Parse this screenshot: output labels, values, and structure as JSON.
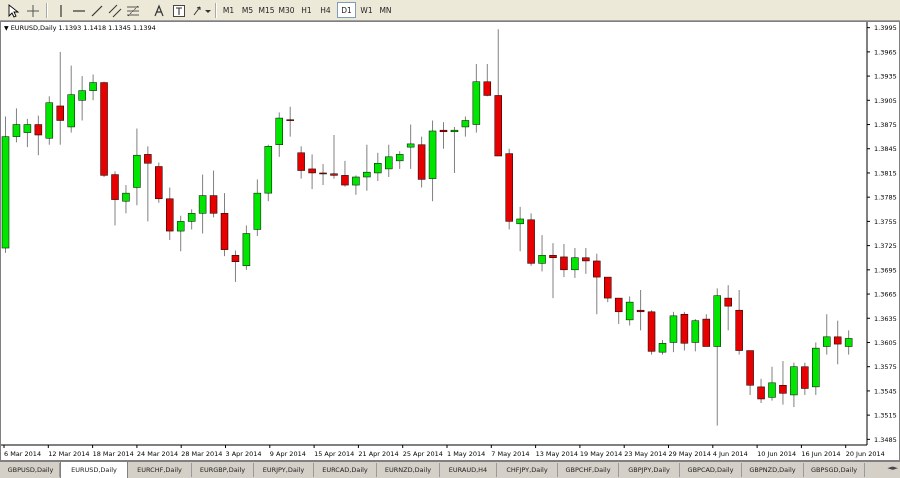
{
  "toolbar": {
    "tools": [
      {
        "name": "cursor-icon"
      },
      {
        "name": "crosshair-icon"
      },
      {
        "name": "vertical-line-icon"
      },
      {
        "name": "horizontal-line-icon"
      },
      {
        "name": "trendline-icon"
      },
      {
        "name": "equidistant-channel-icon"
      },
      {
        "name": "fibonacci-icon"
      },
      {
        "name": "text-icon"
      },
      {
        "name": "text-label-icon"
      },
      {
        "name": "arrows-menu-icon"
      }
    ],
    "timeframes": [
      "M1",
      "M5",
      "M15",
      "M30",
      "H1",
      "H4",
      "D1",
      "W1",
      "MN"
    ],
    "active_timeframe": "D1"
  },
  "chart": {
    "header": "EURUSD,Daily  1.1393 1.1418 1.1345 1.1394",
    "price_labels": [
      "1.3995",
      "1.3965",
      "1.3935",
      "1.3905",
      "1.3875",
      "1.3845",
      "1.3815",
      "1.3785",
      "1.3755",
      "1.3725",
      "1.3695",
      "1.3665",
      "1.3635",
      "1.3605",
      "1.3575",
      "1.3545",
      "1.3515",
      "1.3485"
    ],
    "date_labels": [
      "6 Mar 2014",
      "12 Mar 2014",
      "18 Mar 2014",
      "24 Mar 2014",
      "28 Mar 2014",
      "3 Apr 2014",
      "9 Apr 2014",
      "15 Apr 2014",
      "21 Apr 2014",
      "25 Apr 2014",
      "1 May 2014",
      "7 May 2014",
      "13 May 2014",
      "19 May 2014",
      "23 May 2014",
      "29 May 2014",
      "4 Jun 2014",
      "10 Jun 2014",
      "16 Jun 2014",
      "20 Jun 2014"
    ],
    "colors": {
      "bull": "#00e600",
      "bear": "#e60000",
      "wick": "#808080",
      "outline": "#000000"
    }
  },
  "chart_data": {
    "type": "candlestick",
    "symbol": "EURUSD",
    "timeframe": "Daily",
    "y_range": [
      1.3478,
      1.4002
    ],
    "candles": [
      {
        "o": 1.3722,
        "h": 1.3885,
        "l": 1.3716,
        "c": 1.386
      },
      {
        "o": 1.386,
        "h": 1.3895,
        "l": 1.3853,
        "c": 1.3875
      },
      {
        "o": 1.3865,
        "h": 1.3882,
        "l": 1.3847,
        "c": 1.3875
      },
      {
        "o": 1.3875,
        "h": 1.3886,
        "l": 1.3837,
        "c": 1.3862
      },
      {
        "o": 1.3858,
        "h": 1.391,
        "l": 1.385,
        "c": 1.3902
      },
      {
        "o": 1.3898,
        "h": 1.3965,
        "l": 1.385,
        "c": 1.388
      },
      {
        "o": 1.3872,
        "h": 1.3948,
        "l": 1.3865,
        "c": 1.3912
      },
      {
        "o": 1.3905,
        "h": 1.3935,
        "l": 1.388,
        "c": 1.3917
      },
      {
        "o": 1.3917,
        "h": 1.3937,
        "l": 1.3905,
        "c": 1.3927
      },
      {
        "o": 1.3927,
        "h": 1.3928,
        "l": 1.381,
        "c": 1.3812
      },
      {
        "o": 1.3813,
        "h": 1.3817,
        "l": 1.375,
        "c": 1.3782
      },
      {
        "o": 1.378,
        "h": 1.38,
        "l": 1.3765,
        "c": 1.379
      },
      {
        "o": 1.3797,
        "h": 1.387,
        "l": 1.3775,
        "c": 1.3837
      },
      {
        "o": 1.3838,
        "h": 1.3848,
        "l": 1.3755,
        "c": 1.3827
      },
      {
        "o": 1.3823,
        "h": 1.3828,
        "l": 1.3778,
        "c": 1.3783
      },
      {
        "o": 1.3783,
        "h": 1.3797,
        "l": 1.3732,
        "c": 1.3743
      },
      {
        "o": 1.3743,
        "h": 1.3762,
        "l": 1.3718,
        "c": 1.3755
      },
      {
        "o": 1.3755,
        "h": 1.377,
        "l": 1.3745,
        "c": 1.3765
      },
      {
        "o": 1.3765,
        "h": 1.3813,
        "l": 1.374,
        "c": 1.3787
      },
      {
        "o": 1.3787,
        "h": 1.3818,
        "l": 1.376,
        "c": 1.3765
      },
      {
        "o": 1.3765,
        "h": 1.379,
        "l": 1.3712,
        "c": 1.372
      },
      {
        "o": 1.3713,
        "h": 1.3719,
        "l": 1.368,
        "c": 1.3705
      },
      {
        "o": 1.37,
        "h": 1.375,
        "l": 1.3695,
        "c": 1.374
      },
      {
        "o": 1.3745,
        "h": 1.3807,
        "l": 1.3737,
        "c": 1.379
      },
      {
        "o": 1.379,
        "h": 1.385,
        "l": 1.378,
        "c": 1.3848
      },
      {
        "o": 1.385,
        "h": 1.389,
        "l": 1.3835,
        "c": 1.3883
      },
      {
        "o": 1.3881,
        "h": 1.3897,
        "l": 1.386,
        "c": 1.388
      },
      {
        "o": 1.384,
        "h": 1.3848,
        "l": 1.3808,
        "c": 1.3818
      },
      {
        "o": 1.382,
        "h": 1.3838,
        "l": 1.3795,
        "c": 1.3815
      },
      {
        "o": 1.3815,
        "h": 1.3826,
        "l": 1.38,
        "c": 1.3814
      },
      {
        "o": 1.3814,
        "h": 1.3862,
        "l": 1.3808,
        "c": 1.3812
      },
      {
        "o": 1.3812,
        "h": 1.383,
        "l": 1.3798,
        "c": 1.38
      },
      {
        "o": 1.38,
        "h": 1.3812,
        "l": 1.3788,
        "c": 1.381
      },
      {
        "o": 1.381,
        "h": 1.385,
        "l": 1.3793,
        "c": 1.3816
      },
      {
        "o": 1.3815,
        "h": 1.384,
        "l": 1.3805,
        "c": 1.3827
      },
      {
        "o": 1.382,
        "h": 1.385,
        "l": 1.381,
        "c": 1.3835
      },
      {
        "o": 1.383,
        "h": 1.3842,
        "l": 1.382,
        "c": 1.3838
      },
      {
        "o": 1.3847,
        "h": 1.3875,
        "l": 1.382,
        "c": 1.3851
      },
      {
        "o": 1.385,
        "h": 1.386,
        "l": 1.3797,
        "c": 1.3807
      },
      {
        "o": 1.3808,
        "h": 1.388,
        "l": 1.378,
        "c": 1.3867
      },
      {
        "o": 1.3868,
        "h": 1.3878,
        "l": 1.3845,
        "c": 1.3866
      },
      {
        "o": 1.3866,
        "h": 1.3872,
        "l": 1.3815,
        "c": 1.3868
      },
      {
        "o": 1.3872,
        "h": 1.3885,
        "l": 1.386,
        "c": 1.388
      },
      {
        "o": 1.3875,
        "h": 1.395,
        "l": 1.3865,
        "c": 1.3928
      },
      {
        "o": 1.3928,
        "h": 1.395,
        "l": 1.391,
        "c": 1.3911
      },
      {
        "o": 1.3911,
        "h": 1.3993,
        "l": 1.384,
        "c": 1.3836
      },
      {
        "o": 1.3839,
        "h": 1.3845,
        "l": 1.3745,
        "c": 1.3755
      },
      {
        "o": 1.3752,
        "h": 1.3773,
        "l": 1.3718,
        "c": 1.3758
      },
      {
        "o": 1.3757,
        "h": 1.3765,
        "l": 1.37,
        "c": 1.3703
      },
      {
        "o": 1.3703,
        "h": 1.3738,
        "l": 1.3693,
        "c": 1.3713
      },
      {
        "o": 1.3713,
        "h": 1.3728,
        "l": 1.366,
        "c": 1.371
      },
      {
        "o": 1.3711,
        "h": 1.3727,
        "l": 1.3686,
        "c": 1.3695
      },
      {
        "o": 1.3695,
        "h": 1.3722,
        "l": 1.3685,
        "c": 1.371
      },
      {
        "o": 1.371,
        "h": 1.3722,
        "l": 1.369,
        "c": 1.3706
      },
      {
        "o": 1.3706,
        "h": 1.3715,
        "l": 1.364,
        "c": 1.3686
      },
      {
        "o": 1.3686,
        "h": 1.3686,
        "l": 1.3655,
        "c": 1.366
      },
      {
        "o": 1.366,
        "h": 1.366,
        "l": 1.3628,
        "c": 1.3643
      },
      {
        "o": 1.3633,
        "h": 1.3662,
        "l": 1.3626,
        "c": 1.3655
      },
      {
        "o": 1.3645,
        "h": 1.367,
        "l": 1.362,
        "c": 1.3643
      },
      {
        "o": 1.3643,
        "h": 1.3645,
        "l": 1.359,
        "c": 1.3594
      },
      {
        "o": 1.3593,
        "h": 1.3608,
        "l": 1.359,
        "c": 1.3604
      },
      {
        "o": 1.3605,
        "h": 1.3643,
        "l": 1.3593,
        "c": 1.3638
      },
      {
        "o": 1.364,
        "h": 1.3643,
        "l": 1.3595,
        "c": 1.3604
      },
      {
        "o": 1.3605,
        "h": 1.3634,
        "l": 1.3594,
        "c": 1.3632
      },
      {
        "o": 1.3634,
        "h": 1.364,
        "l": 1.36,
        "c": 1.36
      },
      {
        "o": 1.36,
        "h": 1.3672,
        "l": 1.3502,
        "c": 1.3663
      },
      {
        "o": 1.366,
        "h": 1.3676,
        "l": 1.362,
        "c": 1.365
      },
      {
        "o": 1.3645,
        "h": 1.367,
        "l": 1.359,
        "c": 1.3595
      },
      {
        "o": 1.3595,
        "h": 1.3595,
        "l": 1.354,
        "c": 1.3552
      },
      {
        "o": 1.355,
        "h": 1.356,
        "l": 1.353,
        "c": 1.3535
      },
      {
        "o": 1.3537,
        "h": 1.3575,
        "l": 1.3533,
        "c": 1.3555
      },
      {
        "o": 1.3552,
        "h": 1.3582,
        "l": 1.3528,
        "c": 1.3542
      },
      {
        "o": 1.354,
        "h": 1.358,
        "l": 1.3525,
        "c": 1.3575
      },
      {
        "o": 1.3575,
        "h": 1.358,
        "l": 1.354,
        "c": 1.3548
      },
      {
        "o": 1.355,
        "h": 1.3605,
        "l": 1.354,
        "c": 1.3598
      },
      {
        "o": 1.36,
        "h": 1.364,
        "l": 1.359,
        "c": 1.3612
      },
      {
        "o": 1.3612,
        "h": 1.3632,
        "l": 1.3578,
        "c": 1.3603
      },
      {
        "o": 1.36,
        "h": 1.362,
        "l": 1.359,
        "c": 1.361
      }
    ]
  },
  "tabs": {
    "items": [
      "GBPUSD,Daily",
      "EURUSD,Daily",
      "EURCHF,Daily",
      "EURGBP,Daily",
      "EURJPY,Daily",
      "EURCAD,Daily",
      "EURNZD,Daily",
      "EURAUD,H4",
      "CHFJPY,Daily",
      "GBPCHF,Daily",
      "GBPJPY,Daily",
      "GBPCAD,Daily",
      "GBPNZD,Daily",
      "GBPSGD,Daily"
    ],
    "active": "EURUSD,Daily"
  }
}
